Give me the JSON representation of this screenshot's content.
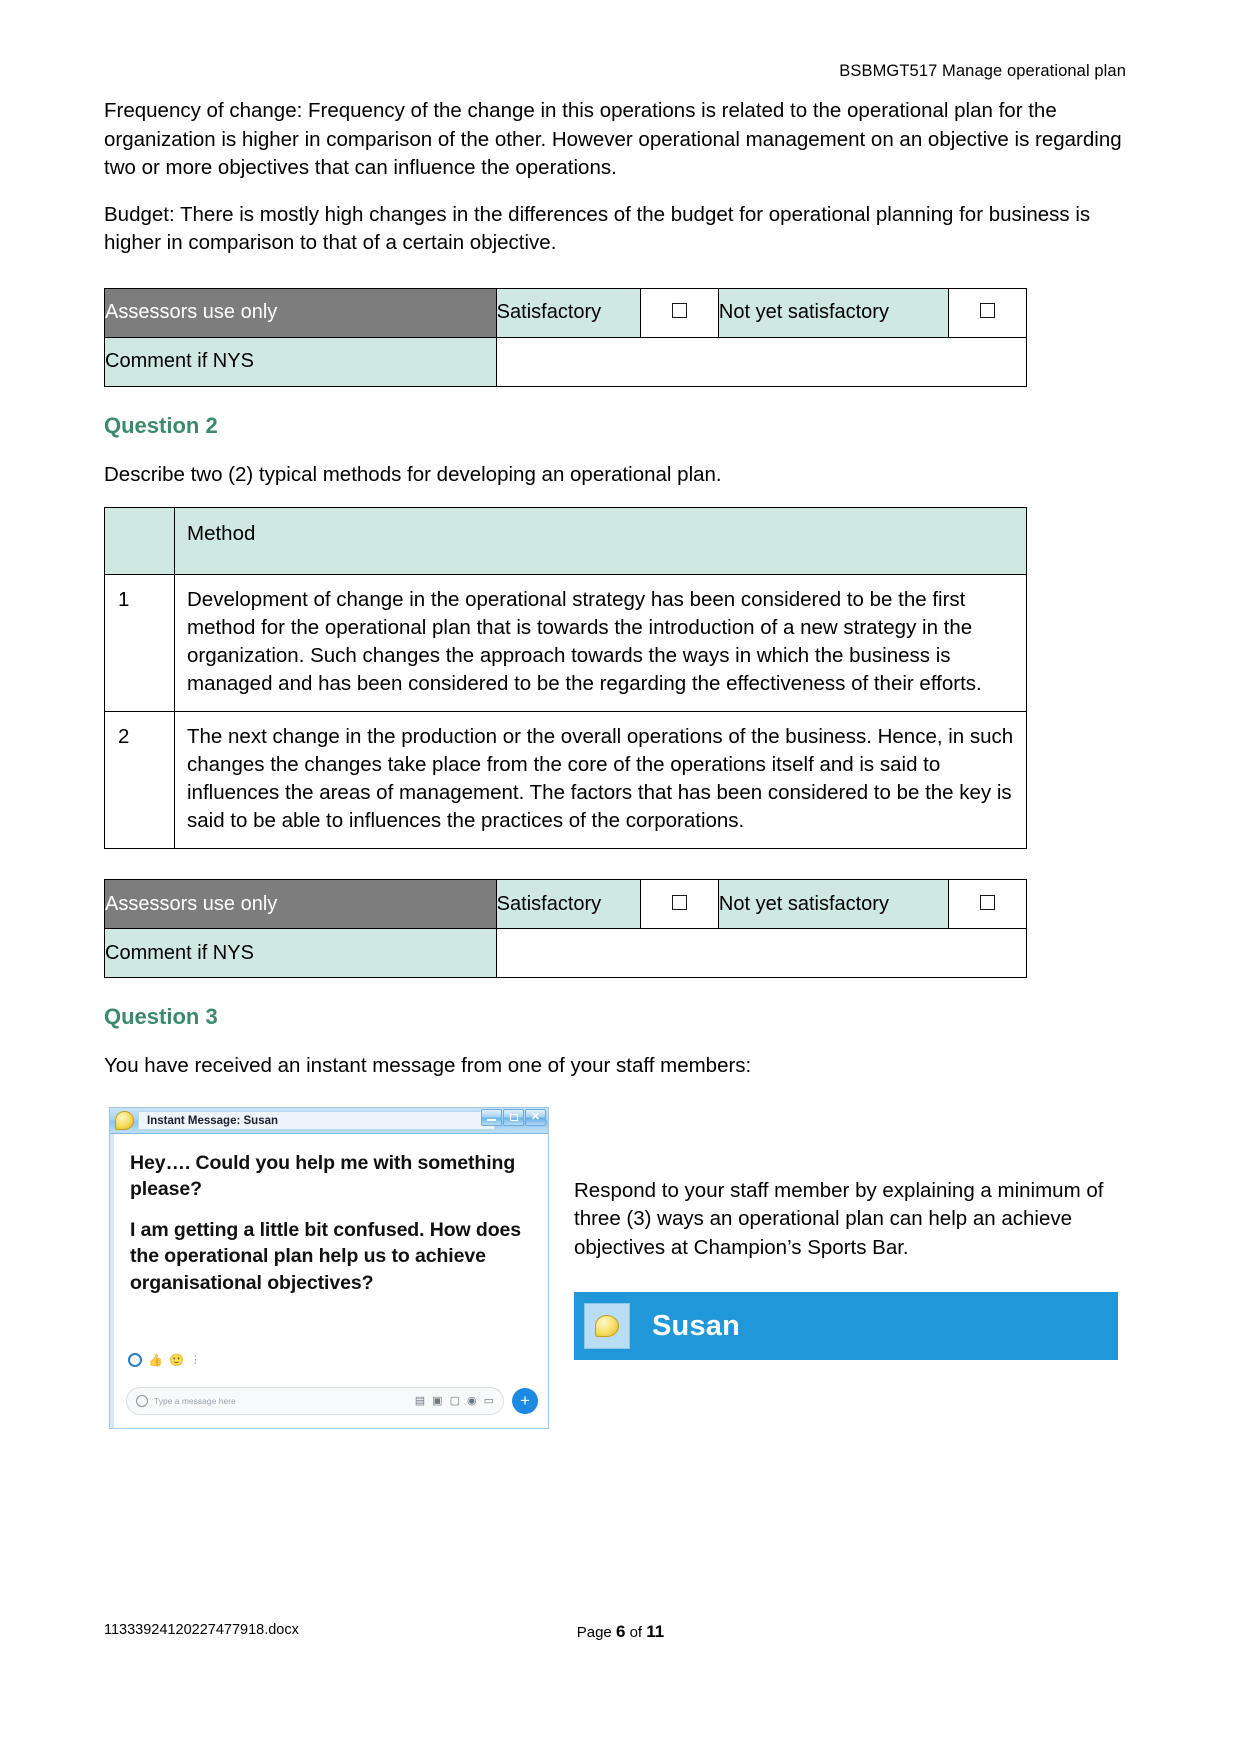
{
  "header": {
    "unit_code_title": "BSBMGT517 Manage operational plan"
  },
  "intro_paragraphs": [
    "Frequency of change: Frequency of the change in this operations is related to the operational plan for the organization is higher in comparison of the other. However operational management on an objective is regarding two or more objectives that can influence the operations.",
    "Budget: There is mostly high changes in the differences of the budget for operational planning for business is higher in comparison to that of a certain objective."
  ],
  "assessor_table": {
    "assessors_label": "Assessors use only",
    "satisfactory_label": "Satisfactory",
    "not_yet_satisfactory_label": "Not yet satisfactory",
    "comment_label": "Comment if NYS",
    "comment_value": "",
    "satisfactory_checked": false,
    "not_yet_satisfactory_checked": false
  },
  "question2": {
    "heading": "Question 2",
    "prompt": "Describe two (2) typical methods for developing an operational plan.",
    "table": {
      "col_number_header": "",
      "col_method_header": "Method",
      "rows": [
        {
          "number": "1",
          "method": "Development of change in the operational strategy has been considered to be the first method for the operational plan that is towards the introduction of a new strategy in the organization. Such changes the approach towards the ways in which the business is managed and has been considered to be the regarding the effectiveness of their efforts."
        },
        {
          "number": "2",
          "method": "The next change in the production or the overall operations of the business. Hence, in such changes the changes take place from the core of the operations itself and is said to influences the areas of management. The factors that has been considered to be the key is said to be able to influences the practices of the corporations."
        }
      ]
    }
  },
  "question3": {
    "heading": "Question 3",
    "prompt": "You have received an instant message from one of your staff members:",
    "instant_message_window": {
      "title": "Instant Message:  Susan",
      "icon": "speech-bubble-icon",
      "window_controls": {
        "minimize": "minimize-icon",
        "maximize": "maximize-icon",
        "close": "close-icon"
      },
      "messages": [
        "Hey…. Could you help me with something please?",
        "I am getting a little bit confused. How does the operational plan help us to achieve organisational objectives?"
      ],
      "composer_placeholder": "Type a message here",
      "composer_icons": [
        "gallery-icon",
        "sticker-icon",
        "camera-icon",
        "location-icon",
        "video-icon"
      ],
      "add_button": "+"
    },
    "response_instruction": "Respond to your staff member by explaining a minimum of three (3) ways an operational plan can help an achieve objectives at Champion’s Sports Bar.",
    "answer_banner": {
      "name": "Susan",
      "background_color": "#1F97D9",
      "avatar_icon": "speech-bubble-icon"
    }
  },
  "footer": {
    "file_name": "11333924120227477918.docx",
    "page_label": "Page",
    "page_number": "6",
    "of_label": "of",
    "total_pages": "11"
  }
}
